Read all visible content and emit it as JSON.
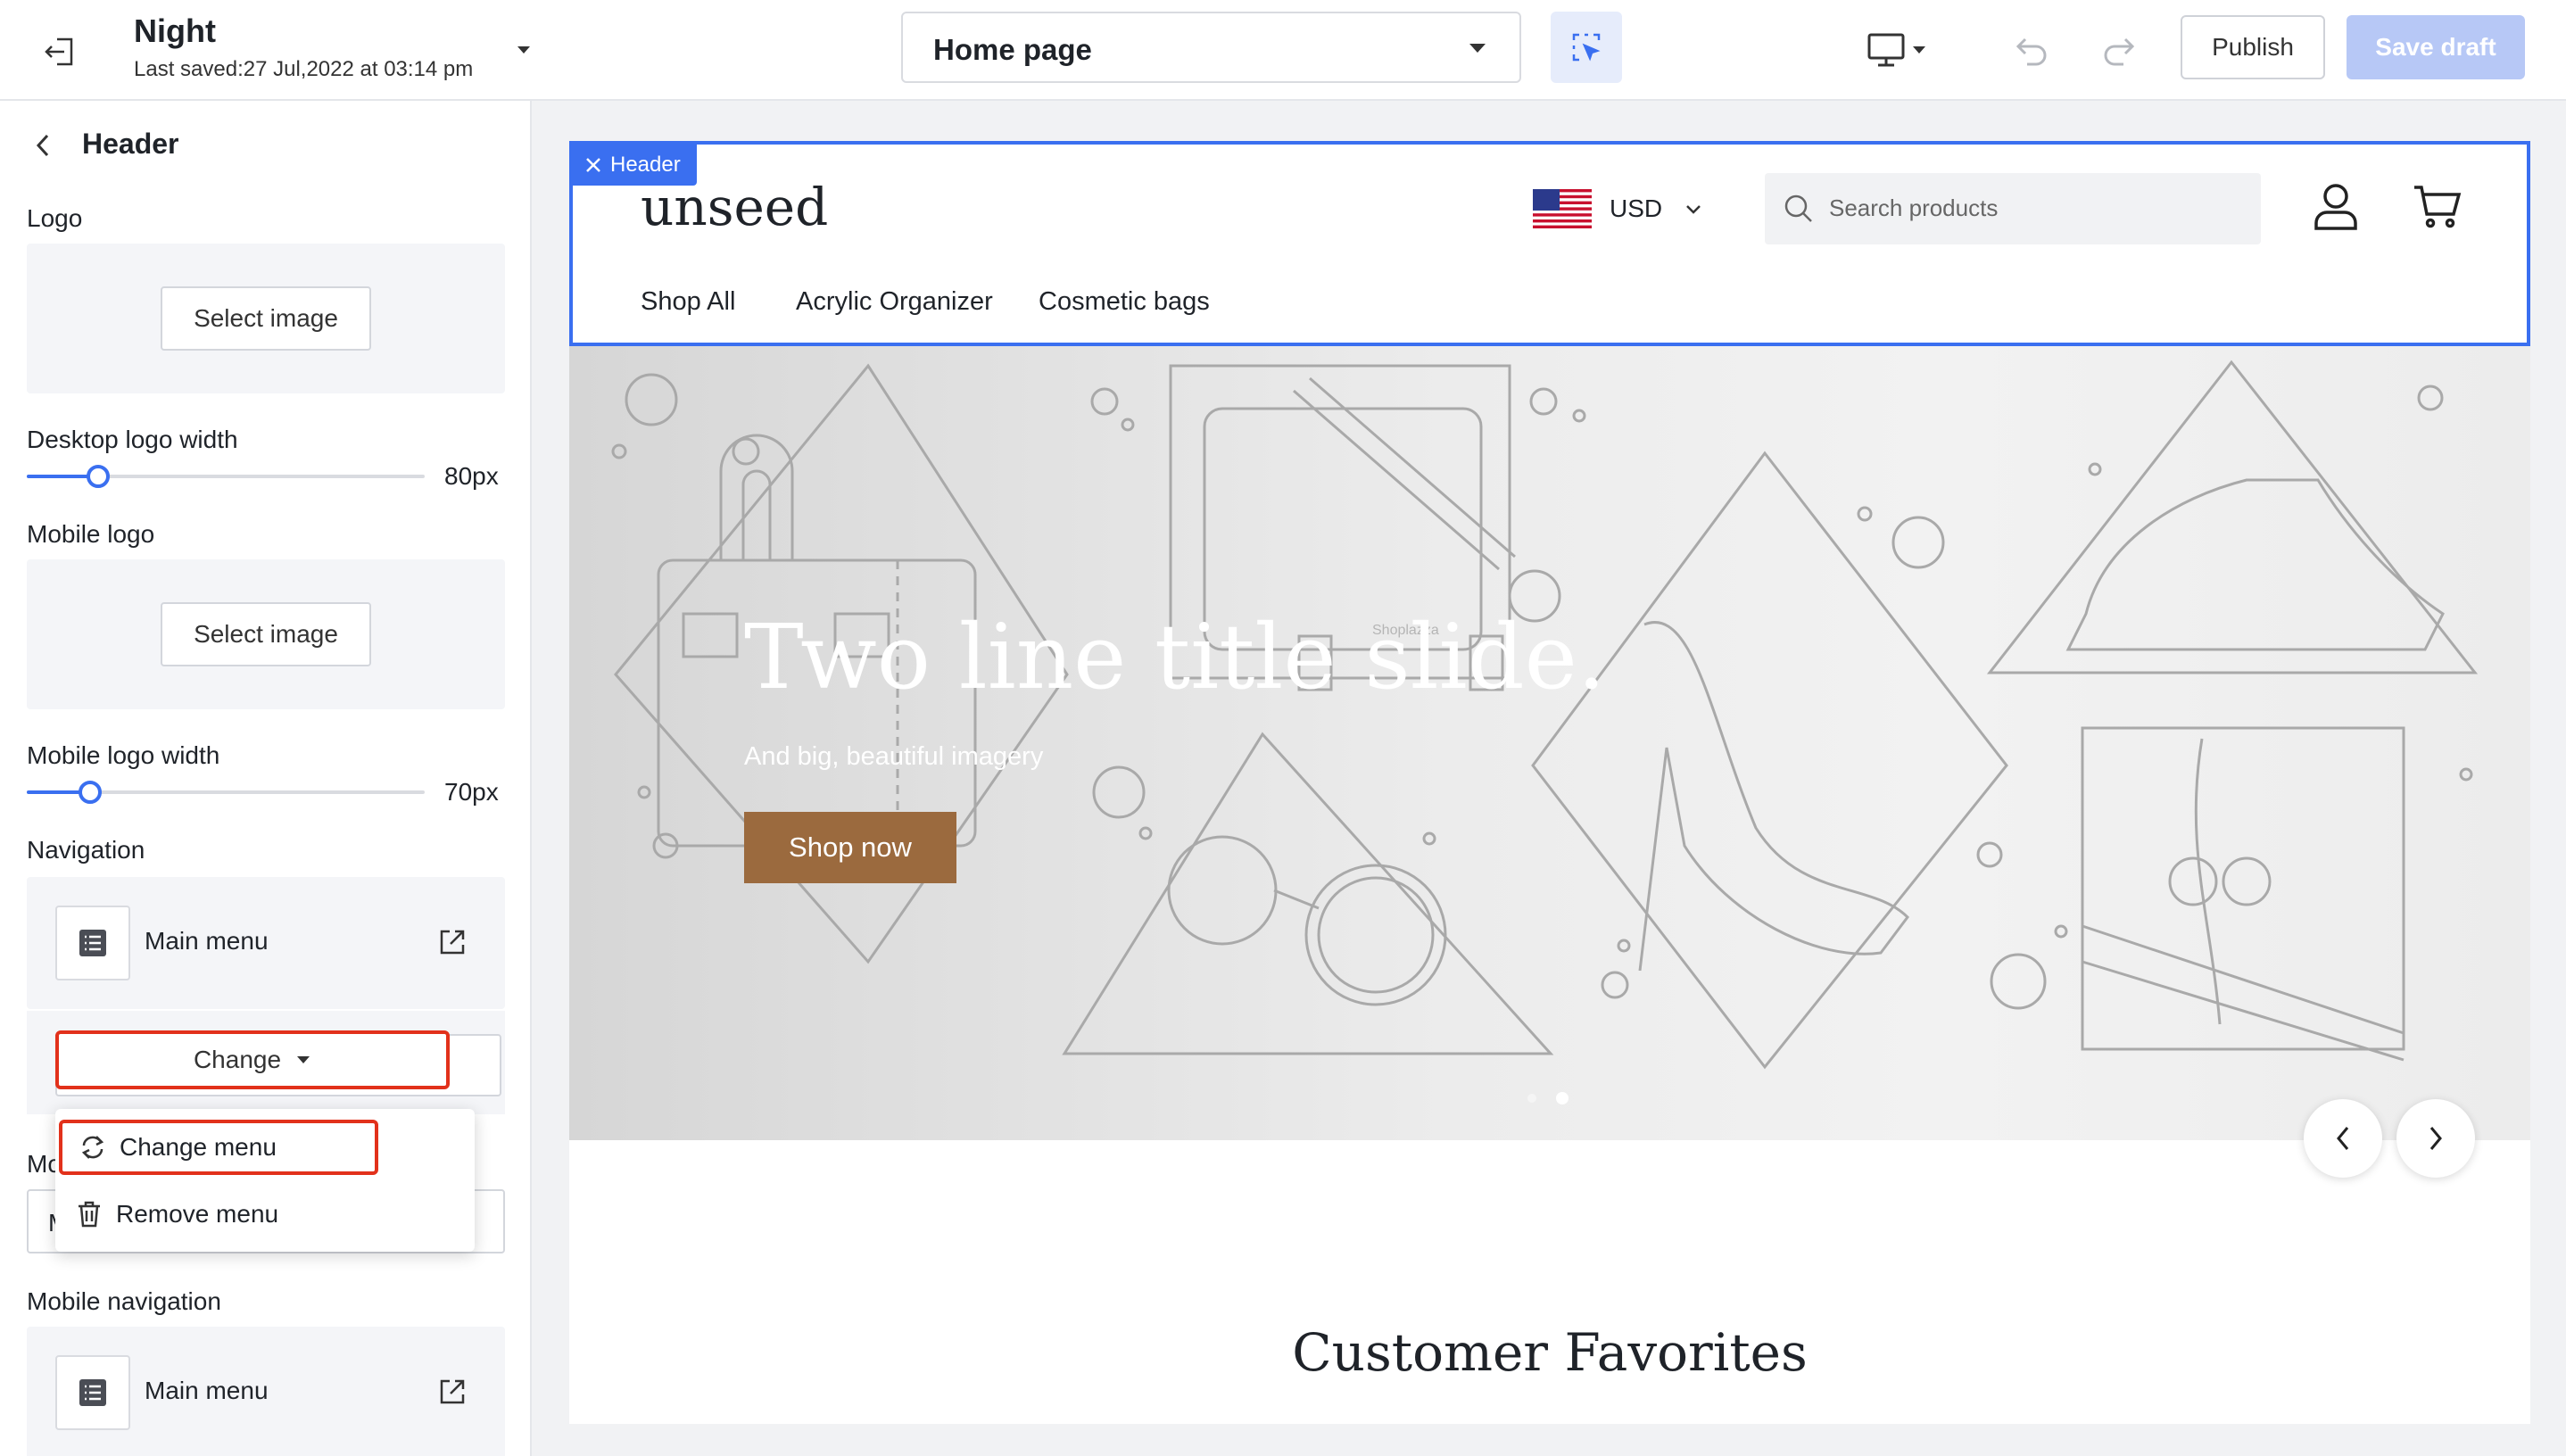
{
  "topbar": {
    "theme_name": "Night",
    "last_saved": "Last saved:27 Jul,2022 at 03:14 pm",
    "page_select": "Home page",
    "publish_label": "Publish",
    "save_draft_label": "Save draft"
  },
  "sidebar": {
    "title": "Header",
    "logo_label": "Logo",
    "select_image_label": "Select image",
    "desktop_logo_width_label": "Desktop logo width",
    "desktop_logo_width_value": "80px",
    "desktop_logo_width_level": 0.18,
    "mobile_logo_label": "Mobile logo",
    "mobile_logo_width_label": "Mobile logo width",
    "mobile_logo_width_value": "70px",
    "mobile_logo_width_level": 0.16,
    "navigation_label": "Navigation",
    "navigation_menu": "Main menu",
    "change_label": "Change",
    "mobile_menu_label_partial": "Mc",
    "mobile_menu_value_partial": "M",
    "mobile_navigation_label": "Mobile navigation",
    "mobile_navigation_menu": "Main menu"
  },
  "dropdown": {
    "change_menu": "Change menu",
    "remove_menu": "Remove menu"
  },
  "preview": {
    "header_tag": "Header",
    "store_logo": "unseed",
    "currency": "USD",
    "search_placeholder": "Search products",
    "nav": [
      "Shop All",
      "Acrylic Organizer",
      "Cosmetic bags"
    ],
    "hero_title": "Two line title slide.",
    "hero_subtitle": "And big, beautiful imagery",
    "hero_button": "Shop now",
    "hero_watermark": "Shoplazza",
    "section_title": "Customer Favorites"
  },
  "colors": {
    "accent": "#3a6ff0",
    "highlight": "#e2311b",
    "hero_button": "#9b6a3e",
    "save_draft_disabled": "#b7c8f6"
  },
  "icons": [
    "exit-icon",
    "caret-down-icon",
    "inspect-icon",
    "desktop-icon",
    "undo-icon",
    "redo-icon",
    "chevron-left-icon",
    "menu-list-icon",
    "external-link-icon",
    "refresh-icon",
    "trash-icon",
    "close-icon",
    "us-flag-icon",
    "search-icon",
    "user-icon",
    "cart-icon",
    "chevron-right-icon"
  ]
}
